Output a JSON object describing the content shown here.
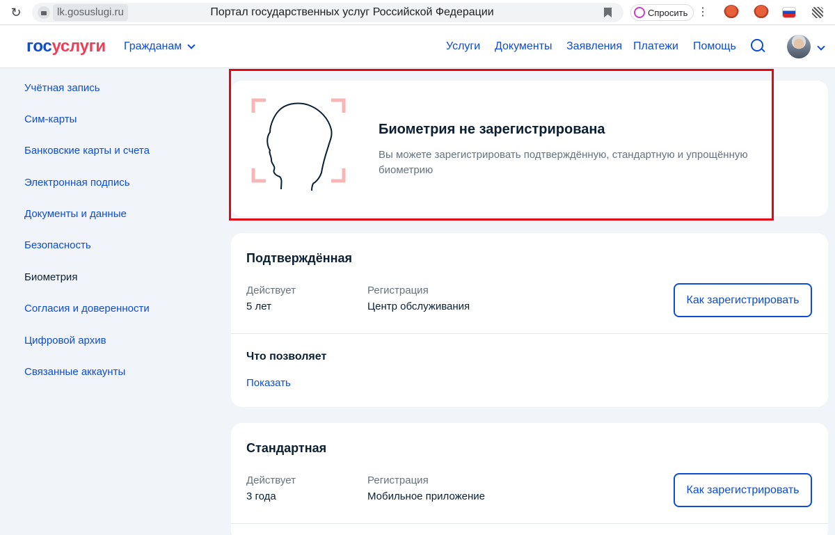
{
  "browser": {
    "url": "lk.gosuslugi.ru",
    "page_title": "Портал государственных услуг Российской Федерации",
    "ask_label": "Спросить"
  },
  "header": {
    "logo_part1": "гос",
    "logo_part2": "услуги",
    "role": "Гражданам",
    "nav": [
      "Услуги",
      "Документы",
      "Заявления",
      "Платежи",
      "Помощь"
    ]
  },
  "sidebar": {
    "items": [
      "Учётная запись",
      "Сим-карты",
      "Банковские карты и счета",
      "Электронная подпись",
      "Документы и данные",
      "Безопасность",
      "Биометрия",
      "Согласия и доверенности",
      "Цифровой архив",
      "Связанные аккаунты"
    ],
    "active_item": "Биометрия"
  },
  "hero": {
    "title": "Биометрия не зарегистрирована",
    "text": "Вы можете зарегистрировать подтверждённую, стандартную и упрощённую биометрию"
  },
  "confirmed": {
    "title": "Подтверждённая",
    "valid_label": "Действует",
    "valid_value": "5 лет",
    "reg_label": "Регистрация",
    "reg_value": "Центр обслуживания",
    "button": "Как зарегистрировать",
    "allows_title": "Что позволяет",
    "show_link": "Показать"
  },
  "standard": {
    "title": "Стандартная",
    "valid_label": "Действует",
    "valid_value": "3 года",
    "reg_label": "Регистрация",
    "reg_value": "Мобильное приложение",
    "button": "Как зарегистрировать"
  },
  "colors": {
    "brand_blue": "#0d4cd3",
    "brand_red": "#ee3f58",
    "highlight_frame": "#e30613"
  }
}
